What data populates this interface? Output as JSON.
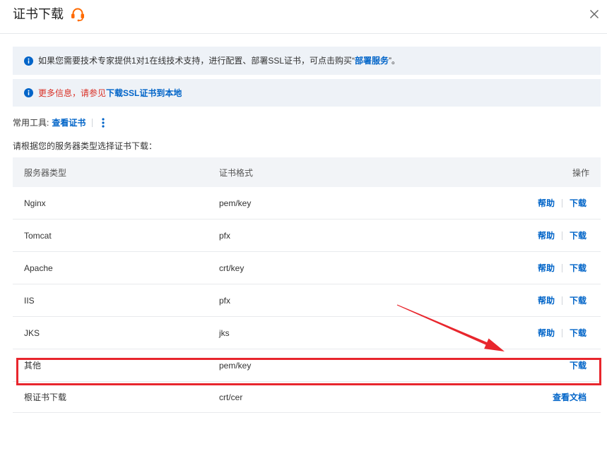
{
  "dialog": {
    "title": "证书下载",
    "title_icon": "headset-icon",
    "close_icon": "close-icon"
  },
  "notices": [
    {
      "icon": "info-icon",
      "text": "如果您需要技术专家提供1对1在线技术支持，进行配置、部署SSL证书，可点击购买“",
      "link": "部署服务",
      "text_after": "”。"
    },
    {
      "icon": "info-icon",
      "text": "更多信息，请参见",
      "link": "下载SSL证书到本地"
    }
  ],
  "tools": {
    "label": "常用工具:",
    "link": "查看证书",
    "more_icon": "more-vertical-icon"
  },
  "instruction": "请根据您的服务器类型选择证书下载：",
  "table": {
    "headers": [
      "服务器类型",
      "证书格式",
      "操作"
    ],
    "rows": [
      {
        "server": "Nginx",
        "format": "pem/key",
        "actions": [
          "帮助",
          "下载"
        ]
      },
      {
        "server": "Tomcat",
        "format": "pfx",
        "actions": [
          "帮助",
          "下载"
        ]
      },
      {
        "server": "Apache",
        "format": "crt/key",
        "actions": [
          "帮助",
          "下载"
        ]
      },
      {
        "server": "IIS",
        "format": "pfx",
        "actions": [
          "帮助",
          "下载"
        ]
      },
      {
        "server": "JKS",
        "format": "jks",
        "actions": [
          "帮助",
          "下载"
        ]
      },
      {
        "server": "其他",
        "format": "pem/key",
        "actions": [
          "下载"
        ]
      },
      {
        "server": "根证书下载",
        "format": "crt/cer",
        "actions": [
          "查看文档"
        ]
      }
    ]
  },
  "colors": {
    "link": "#0064c8",
    "warning_text": "#d93026",
    "brand_icon": "#ff6a00",
    "annotation": "#e8262d",
    "notice_bg": "#eef2f7",
    "table_header_bg": "#f2f4f7"
  }
}
